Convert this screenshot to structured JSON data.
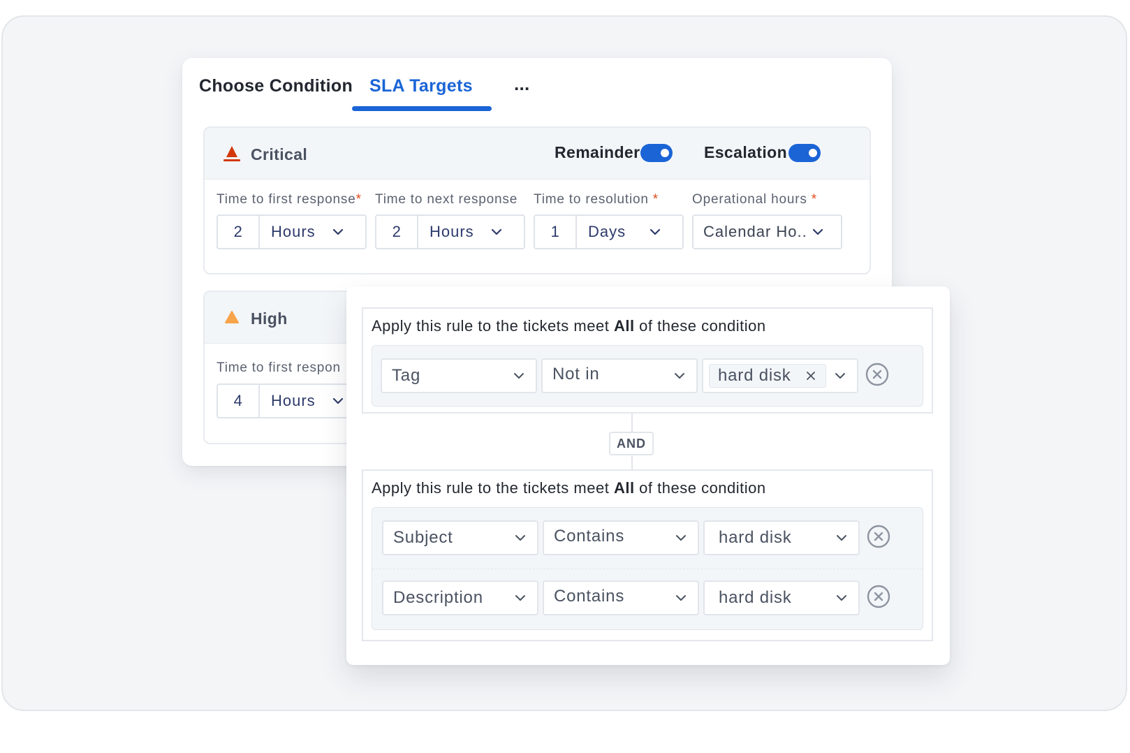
{
  "tabs": {
    "choose": "Choose Condition",
    "sla": "SLA Targets",
    "more": "..."
  },
  "critical": {
    "title": "Critical",
    "remainder_label": "Remainder",
    "escalation_label": "Escalation",
    "remainder_on": true,
    "escalation_on": true,
    "fields": {
      "first_response_label": "Time to first response",
      "next_response_label": "Time to next response",
      "resolution_label": "Time to resolution",
      "operational_label": "Operational hours",
      "required_mark": "*",
      "first_response_value": "2",
      "first_response_unit": "Hours",
      "next_response_value": "2",
      "next_response_unit": "Hours",
      "resolution_value": "1",
      "resolution_unit": "Days",
      "operational_value": "Calendar Ho.."
    },
    "icon_color": "#d4380d"
  },
  "high": {
    "title": "High",
    "first_response_label": "Time to first respon",
    "first_response_value": "4",
    "first_response_unit": "Hours",
    "icon_color": "#f7a44a"
  },
  "rules": {
    "prefix": "Apply this rule to the tickets meet ",
    "emphasis": "All",
    "suffix": " of these condition",
    "and_label": "AND",
    "group1": {
      "field": "Tag",
      "operator": "Not in",
      "value_chip": "hard disk"
    },
    "group2": {
      "row1": {
        "field": "Subject",
        "operator": "Contains",
        "value": "hard disk"
      },
      "row2": {
        "field": "Description",
        "operator": "Contains",
        "value": "hard disk"
      }
    }
  },
  "colors": {
    "accent": "#1a64d6"
  }
}
